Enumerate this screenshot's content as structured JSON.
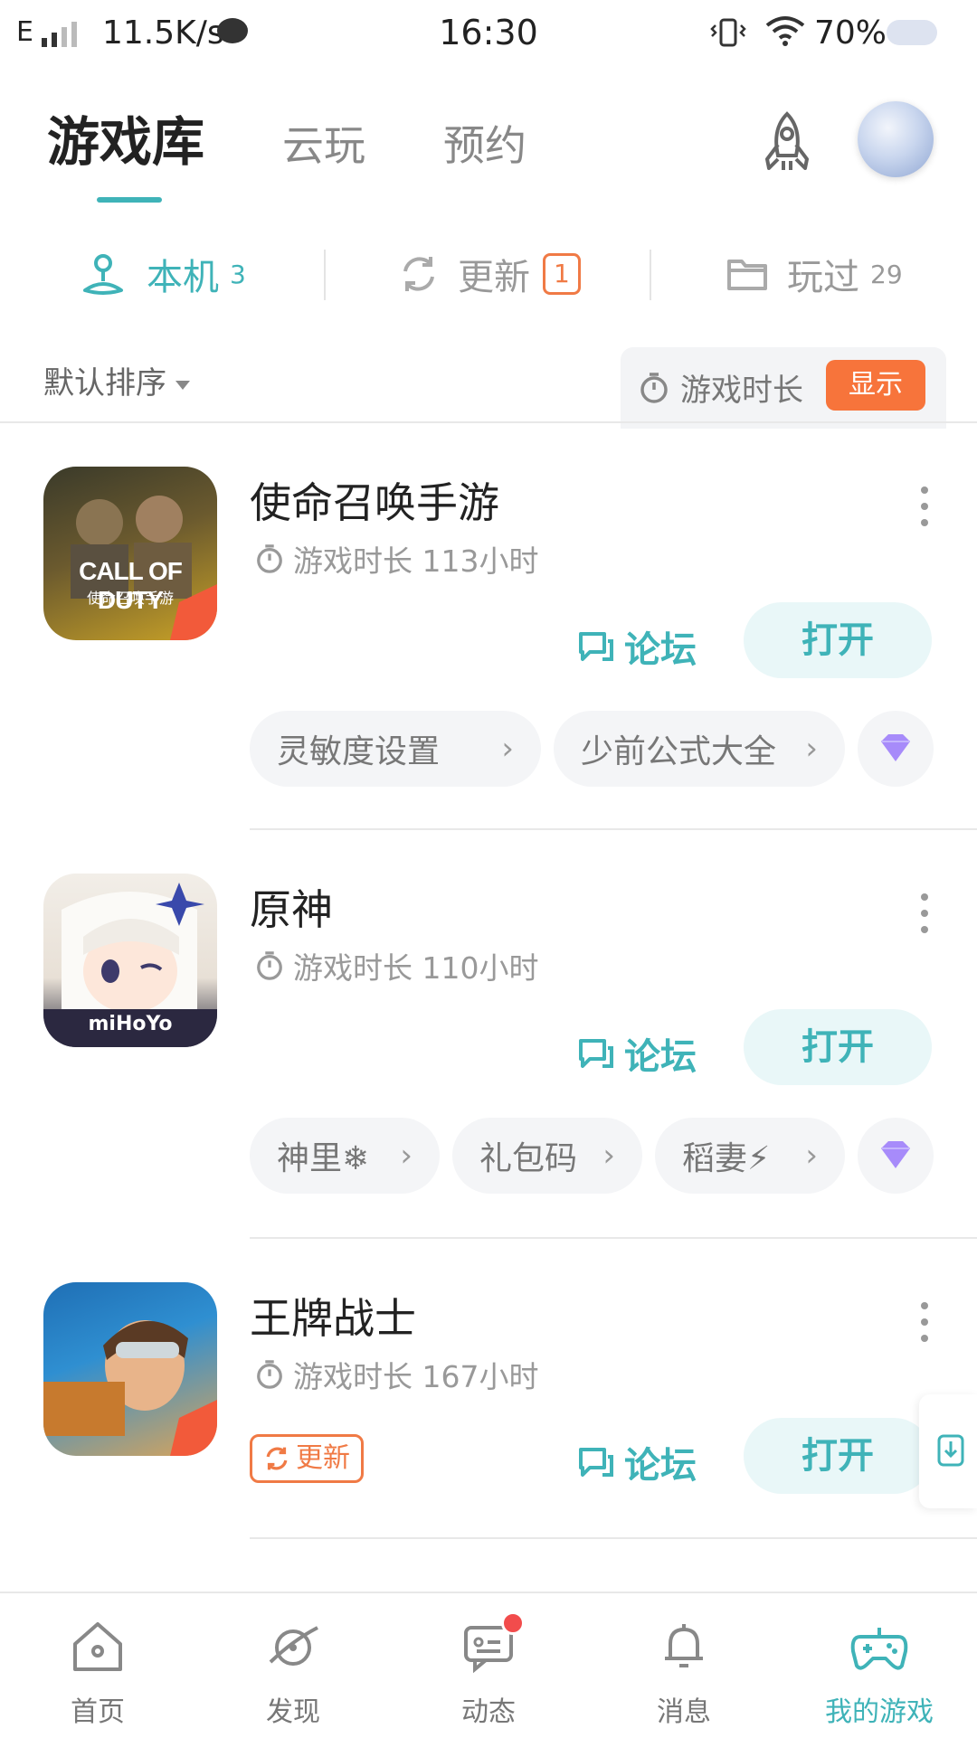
{
  "status_bar": {
    "network": "E",
    "speed": "11.5K/s",
    "time": "16:30",
    "battery": "70%"
  },
  "header": {
    "tabs": [
      {
        "label": "游戏库",
        "active": true
      },
      {
        "label": "云玩",
        "active": false
      },
      {
        "label": "预约",
        "active": false
      }
    ]
  },
  "filters": {
    "local": {
      "label": "本机",
      "count": "3"
    },
    "update": {
      "label": "更新",
      "count": "1"
    },
    "played": {
      "label": "玩过",
      "count": "29"
    }
  },
  "sort": {
    "label": "默认排序",
    "playtime_label": "游戏时长",
    "show_button": "显示"
  },
  "games": [
    {
      "name": "使命召唤手游",
      "playtime": "游戏时长 113小时",
      "icon_text": "CALL OF DUTY",
      "icon_subtext": "使命召唤手游",
      "forum_label": "论坛",
      "open_label": "打开",
      "chips": [
        "灵敏度设置",
        "少前公式大全"
      ]
    },
    {
      "name": "原神",
      "playtime": "游戏时长 110小时",
      "icon_text": "miHoYo",
      "forum_label": "论坛",
      "open_label": "打开",
      "chips": [
        "神里❄",
        "礼包码",
        "稻妻⚡"
      ]
    },
    {
      "name": "王牌战士",
      "playtime": "游戏时长 167小时",
      "update_label": "更新",
      "forum_label": "论坛",
      "open_label": "打开"
    }
  ],
  "bottom_nav": [
    {
      "label": "首页",
      "icon": "home-icon"
    },
    {
      "label": "发现",
      "icon": "planet-icon"
    },
    {
      "label": "动态",
      "icon": "chat-icon"
    },
    {
      "label": "消息",
      "icon": "bell-icon"
    },
    {
      "label": "我的游戏",
      "icon": "gamepad-icon",
      "active": true
    }
  ],
  "colors": {
    "accent": "#3fb3b8",
    "orange": "#f7743b",
    "badge_red": "#f24c4c"
  }
}
